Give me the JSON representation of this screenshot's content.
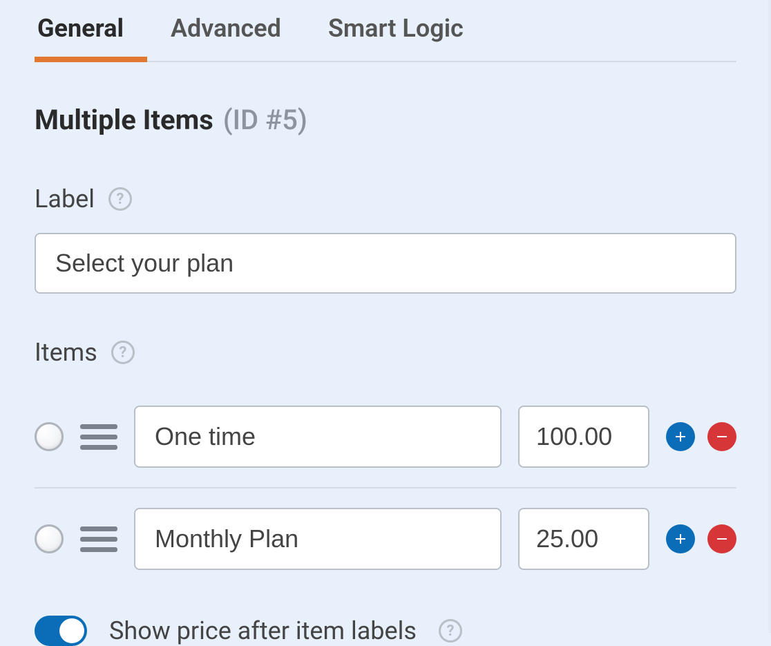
{
  "tabs": {
    "general": "General",
    "advanced": "Advanced",
    "smart_logic": "Smart Logic"
  },
  "section": {
    "title": "Multiple Items",
    "id": "(ID #5)"
  },
  "label_field": {
    "heading": "Label",
    "value": "Select your plan"
  },
  "items_field": {
    "heading": "Items",
    "rows": [
      {
        "name": "One time",
        "price": "100.00"
      },
      {
        "name": "Monthly Plan",
        "price": "25.00"
      }
    ]
  },
  "show_price_toggle": {
    "label": "Show price after item labels",
    "on": true
  }
}
